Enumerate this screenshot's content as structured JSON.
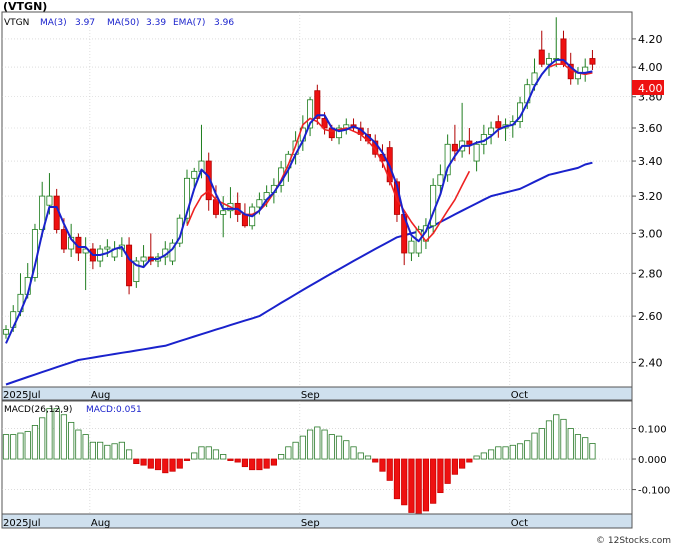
{
  "ticker_label": "(VTGN)",
  "watermark": "© 12Stocks.com",
  "colors": {
    "up": "#1e7d1e",
    "down": "#ee1111",
    "ma3": "#1a22cc",
    "ma50": "#1a22cc",
    "ema7": "#ee2222",
    "macd_bar": "#2a7a2a",
    "axis_band": "#cfe0ee",
    "grid": "#c8c8c8",
    "price_box": "#ee1111"
  },
  "chart_data": [
    {
      "type": "candlestick",
      "title": "(VTGN)",
      "legend": [
        {
          "name": "VTGN",
          "color": "#000000"
        },
        {
          "name": "MA(3)",
          "value": "3.97",
          "color": "#1a22cc"
        },
        {
          "name": "MA(50)",
          "value": "3.39",
          "color": "#1a22cc"
        },
        {
          "name": "EMA(7)",
          "value": "3.96",
          "color": "#ee2222"
        }
      ],
      "y_scale": "log",
      "ylim": [
        2.3,
        4.4
      ],
      "y_ticks": [
        "4.20",
        "4.00",
        "3.80",
        "3.60",
        "3.40",
        "3.20",
        "3.00",
        "2.80",
        "2.60",
        "2.40"
      ],
      "last_price_label": "4.00",
      "x_labels": [
        {
          "label": "2025Jul",
          "index": 0
        },
        {
          "label": "Aug",
          "index": 12
        },
        {
          "label": "Sep",
          "index": 41
        },
        {
          "label": "Oct",
          "index": 70
        }
      ],
      "candles": [
        [
          2.52,
          2.56,
          2.5,
          2.54
        ],
        [
          2.55,
          2.65,
          2.53,
          2.62
        ],
        [
          2.62,
          2.8,
          2.6,
          2.7
        ],
        [
          2.7,
          2.85,
          2.68,
          2.78
        ],
        [
          2.78,
          3.05,
          2.76,
          3.02
        ],
        [
          3.02,
          3.28,
          2.98,
          3.2
        ],
        [
          3.15,
          3.33,
          3.1,
          3.2
        ],
        [
          3.2,
          3.24,
          3.0,
          3.02
        ],
        [
          3.02,
          3.08,
          2.9,
          2.92
        ],
        [
          2.92,
          3.05,
          2.88,
          2.98
        ],
        [
          2.98,
          3.0,
          2.86,
          2.9
        ],
        [
          2.9,
          2.98,
          2.72,
          2.92
        ],
        [
          2.92,
          2.95,
          2.82,
          2.86
        ],
        [
          2.86,
          2.94,
          2.83,
          2.92
        ],
        [
          2.92,
          2.97,
          2.88,
          2.93
        ],
        [
          2.88,
          2.96,
          2.86,
          2.92
        ],
        [
          2.92,
          2.98,
          2.88,
          2.94
        ],
        [
          2.94,
          2.98,
          2.7,
          2.74
        ],
        [
          2.76,
          2.88,
          2.73,
          2.86
        ],
        [
          2.86,
          2.94,
          2.83,
          2.88
        ],
        [
          2.88,
          3.0,
          2.84,
          2.86
        ],
        [
          2.86,
          2.9,
          2.83,
          2.88
        ],
        [
          2.88,
          2.96,
          2.84,
          2.92
        ],
        [
          2.86,
          2.97,
          2.84,
          2.95
        ],
        [
          2.95,
          3.1,
          2.93,
          3.08
        ],
        [
          3.08,
          3.35,
          3.05,
          3.3
        ],
        [
          3.3,
          3.36,
          3.25,
          3.34
        ],
        [
          3.34,
          3.62,
          3.3,
          3.4
        ],
        [
          3.4,
          3.45,
          3.12,
          3.18
        ],
        [
          3.18,
          3.26,
          3.08,
          3.1
        ],
        [
          3.1,
          3.2,
          2.98,
          3.12
        ],
        [
          3.12,
          3.25,
          3.08,
          3.16
        ],
        [
          3.16,
          3.22,
          3.06,
          3.1
        ],
        [
          3.1,
          3.16,
          3.03,
          3.04
        ],
        [
          3.04,
          3.16,
          3.02,
          3.14
        ],
        [
          3.14,
          3.22,
          3.1,
          3.18
        ],
        [
          3.18,
          3.26,
          3.14,
          3.22
        ],
        [
          3.22,
          3.3,
          3.16,
          3.26
        ],
        [
          3.26,
          3.4,
          3.22,
          3.36
        ],
        [
          3.36,
          3.46,
          3.28,
          3.44
        ],
        [
          3.44,
          3.58,
          3.38,
          3.52
        ],
        [
          3.52,
          3.68,
          3.46,
          3.6
        ],
        [
          3.6,
          3.8,
          3.55,
          3.78
        ],
        [
          3.84,
          3.88,
          3.62,
          3.66
        ],
        [
          3.66,
          3.7,
          3.56,
          3.6
        ],
        [
          3.6,
          3.62,
          3.52,
          3.54
        ],
        [
          3.54,
          3.62,
          3.5,
          3.6
        ],
        [
          3.6,
          3.66,
          3.56,
          3.62
        ],
        [
          3.62,
          3.66,
          3.58,
          3.6
        ],
        [
          3.6,
          3.64,
          3.52,
          3.56
        ],
        [
          3.56,
          3.6,
          3.5,
          3.52
        ],
        [
          3.52,
          3.56,
          3.42,
          3.44
        ],
        [
          3.44,
          3.5,
          3.36,
          3.4
        ],
        [
          3.48,
          3.52,
          3.26,
          3.28
        ],
        [
          3.28,
          3.3,
          3.06,
          3.1
        ],
        [
          3.1,
          3.12,
          2.84,
          2.9
        ],
        [
          2.9,
          2.98,
          2.86,
          2.96
        ],
        [
          2.9,
          3.04,
          2.88,
          3.02
        ],
        [
          2.96,
          3.08,
          2.92,
          3.04
        ],
        [
          3.04,
          3.3,
          3.0,
          3.26
        ],
        [
          3.26,
          3.38,
          3.22,
          3.32
        ],
        [
          3.32,
          3.56,
          3.28,
          3.5
        ],
        [
          3.5,
          3.62,
          3.4,
          3.46
        ],
        [
          3.46,
          3.76,
          3.42,
          3.52
        ],
        [
          3.52,
          3.6,
          3.44,
          3.5
        ],
        [
          3.4,
          3.52,
          3.34,
          3.5
        ],
        [
          3.5,
          3.62,
          3.44,
          3.56
        ],
        [
          3.56,
          3.64,
          3.5,
          3.6
        ],
        [
          3.64,
          3.68,
          3.54,
          3.6
        ],
        [
          3.6,
          3.66,
          3.52,
          3.62
        ],
        [
          3.62,
          3.68,
          3.54,
          3.64
        ],
        [
          3.64,
          3.8,
          3.6,
          3.76
        ],
        [
          3.76,
          3.92,
          3.72,
          3.88
        ],
        [
          3.88,
          4.06,
          3.84,
          3.96
        ],
        [
          4.12,
          4.26,
          4.0,
          4.02
        ],
        [
          4.02,
          4.1,
          3.94,
          4.06
        ],
        [
          4.06,
          4.36,
          4.0,
          4.06
        ],
        [
          4.2,
          4.26,
          4.0,
          4.02
        ],
        [
          4.02,
          4.1,
          3.88,
          3.92
        ],
        [
          3.92,
          4.0,
          3.88,
          3.96
        ],
        [
          3.96,
          4.06,
          3.9,
          4.0
        ],
        [
          4.06,
          4.12,
          3.98,
          4.02
        ]
      ],
      "ma3": [
        2.48,
        2.55,
        2.62,
        2.7,
        2.84,
        3.0,
        3.14,
        3.14,
        3.05,
        2.97,
        2.93,
        2.93,
        2.89,
        2.89,
        2.9,
        2.92,
        2.93,
        2.87,
        2.84,
        2.83,
        2.87,
        2.87,
        2.89,
        2.92,
        2.98,
        3.11,
        3.24,
        3.35,
        3.31,
        3.21,
        3.13,
        3.13,
        3.13,
        3.1,
        3.09,
        3.12,
        3.18,
        3.22,
        3.28,
        3.35,
        3.44,
        3.52,
        3.63,
        3.68,
        3.68,
        3.6,
        3.58,
        3.59,
        3.61,
        3.59,
        3.55,
        3.51,
        3.45,
        3.37,
        3.26,
        3.09,
        2.99,
        2.96,
        3.01,
        3.11,
        3.21,
        3.36,
        3.43,
        3.49,
        3.49,
        3.51,
        3.52,
        3.55,
        3.59,
        3.61,
        3.62,
        3.67,
        3.76,
        3.87,
        3.95,
        4.01,
        4.05,
        4.05,
        4.0,
        3.96,
        3.96,
        3.97
      ],
      "ema7": [
        null,
        null,
        null,
        null,
        null,
        null,
        null,
        null,
        null,
        null,
        null,
        null,
        null,
        null,
        null,
        null,
        null,
        null,
        null,
        null,
        null,
        null,
        null,
        null,
        null,
        3.04,
        3.13,
        3.2,
        3.23,
        3.18,
        3.16,
        3.14,
        3.12,
        3.1,
        3.1,
        3.12,
        3.16,
        3.22,
        3.29,
        3.38,
        3.49,
        3.62,
        3.66,
        3.64,
        3.59,
        3.58,
        3.59,
        3.6,
        3.58,
        3.56,
        3.52,
        3.47,
        3.39,
        3.29,
        3.18,
        3.12,
        3.06,
        3.01,
        2.96,
        3.0,
        3.06,
        3.12,
        3.18,
        3.26,
        3.34,
        null,
        null,
        null,
        null,
        null,
        null,
        null,
        null,
        null,
        null,
        4.0,
        4.02,
        4.02,
        3.98,
        3.96,
        3.95,
        3.96
      ],
      "ma50": [
        2.31,
        2.32,
        2.33,
        2.34,
        2.35,
        2.36,
        2.37,
        2.38,
        2.39,
        2.4,
        2.41,
        2.415,
        2.42,
        2.425,
        2.43,
        2.435,
        2.44,
        2.445,
        2.45,
        2.455,
        2.46,
        2.465,
        2.47,
        2.48,
        2.49,
        2.5,
        2.51,
        2.52,
        2.53,
        2.54,
        2.55,
        2.56,
        2.57,
        2.58,
        2.59,
        2.6,
        2.62,
        2.64,
        2.66,
        2.68,
        2.7,
        2.72,
        2.74,
        2.76,
        2.78,
        2.8,
        2.82,
        2.84,
        2.86,
        2.88,
        2.9,
        2.92,
        2.94,
        2.96,
        2.98,
        2.99,
        3.0,
        3.01,
        3.02,
        3.04,
        3.06,
        3.08,
        3.1,
        3.12,
        3.14,
        3.16,
        3.18,
        3.2,
        3.21,
        3.22,
        3.23,
        3.24,
        3.26,
        3.28,
        3.3,
        3.32,
        3.33,
        3.34,
        3.35,
        3.36,
        3.38,
        3.39
      ]
    },
    {
      "type": "bar",
      "title": "MACD(26,12,9)",
      "legend": [
        {
          "name": "MACD(26,12,9)",
          "color": "#000000"
        },
        {
          "name": "MACD:",
          "value": "0.051",
          "color": "#1a22cc"
        }
      ],
      "ylim": [
        -0.18,
        0.19
      ],
      "y_ticks": [
        "0.100",
        "0.000",
        "-0.100"
      ],
      "values": [
        0.08,
        0.08,
        0.085,
        0.09,
        0.11,
        0.135,
        0.165,
        0.165,
        0.145,
        0.12,
        0.095,
        0.08,
        0.055,
        0.055,
        0.045,
        0.05,
        0.055,
        0.03,
        -0.015,
        -0.02,
        -0.03,
        -0.035,
        -0.045,
        -0.04,
        -0.03,
        -0.005,
        0.02,
        0.04,
        0.04,
        0.03,
        0.015,
        -0.005,
        -0.01,
        -0.025,
        -0.035,
        -0.035,
        -0.03,
        -0.02,
        0.015,
        0.04,
        0.055,
        0.075,
        0.095,
        0.105,
        0.095,
        0.08,
        0.075,
        0.06,
        0.04,
        0.02,
        0.01,
        -0.01,
        -0.04,
        -0.07,
        -0.13,
        -0.15,
        -0.175,
        -0.18,
        -0.17,
        -0.145,
        -0.11,
        -0.08,
        -0.05,
        -0.03,
        -0.01,
        0.01,
        0.02,
        0.03,
        0.04,
        0.04,
        0.045,
        0.05,
        0.06,
        0.085,
        0.1,
        0.125,
        0.145,
        0.13,
        0.1,
        0.08,
        0.07,
        0.051
      ]
    }
  ]
}
